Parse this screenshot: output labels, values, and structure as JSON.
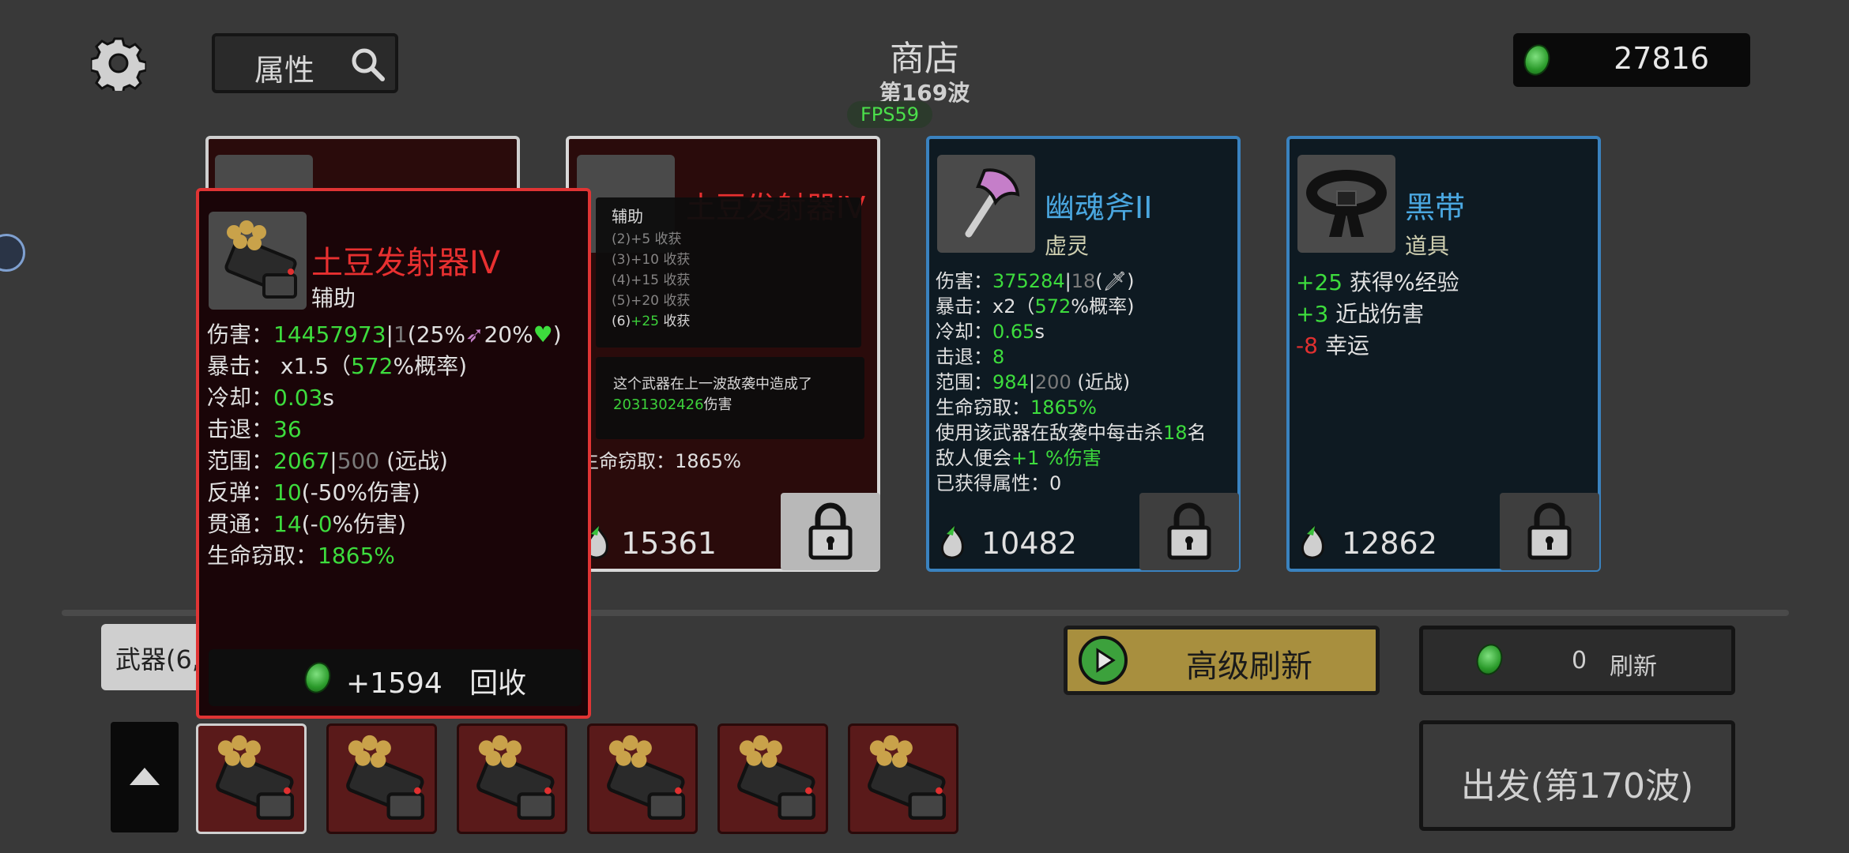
{
  "topbar": {
    "search_label": "属性",
    "title": "商店",
    "wave": "第169波",
    "fps": "FPS59",
    "money": "27816"
  },
  "cards": [
    {
      "name": "",
      "type": "",
      "price": ""
    },
    {
      "name": "土豆发射器IV",
      "type": "辅助",
      "price": "15361",
      "stats_partial": [
        "生命窃取：1865%"
      ]
    },
    {
      "name": "幽魂斧II",
      "type": "虚灵",
      "price": "10482",
      "stats": {
        "damage_label": "伤害：",
        "damage": "375284",
        "damage_sep": "|",
        "damage_base": "18",
        "damage_tail": "(🗡)",
        "crit_label": "暴击：",
        "crit": "x2（",
        "crit_chance": "572",
        "crit_tail": "%概率)",
        "cooldown_label": "冷却：",
        "cooldown": "0.65",
        "cooldown_unit": "s",
        "knockback_label": "击退：",
        "knockback": "8",
        "range_label": "范围：",
        "range": "984",
        "range_sep": "|",
        "range_base": "200",
        "range_tail": " (近战)",
        "lifesteal_label": "生命窃取：",
        "lifesteal": "1865%",
        "effect_1": "使用该武器在敌袭中每击杀",
        "effect_kills": "18",
        "effect_2": "名",
        "effect_3": "敌人便会",
        "effect_bonus": "+1 %伤害",
        "gained_label": "已获得属性：",
        "gained": "0"
      }
    },
    {
      "name": "黑带",
      "type": "道具",
      "price": "12862",
      "effects": [
        {
          "value": "+25",
          "text": " 获得%经验",
          "color": "green"
        },
        {
          "value": "+3",
          "text": " 近战伤害",
          "color": "green"
        },
        {
          "value": "-8",
          "text": " 幸运",
          "color": "red"
        }
      ]
    }
  ],
  "tooltip": {
    "name": "土豆发射器IV",
    "type": "辅助",
    "damage_label": "伤害：",
    "damage": "14457973",
    "damage_sep": "|",
    "damage_base": "1",
    "damage_tail": "(25%",
    "damage_tail2": "20%",
    "damage_end": ")",
    "crit_label": "暴击：",
    "crit": " x1.5（",
    "crit_chance": "572",
    "crit_tail": "%概率)",
    "cooldown_label": "冷却：",
    "cooldown": "0.03",
    "cooldown_unit": "s",
    "knockback_label": "击退：",
    "knockback": "36",
    "range_label": "范围：",
    "range": "2067",
    "range_sep": "|",
    "range_base": "500",
    "range_tail": " (远战)",
    "bounce_label": "反弹：",
    "bounce": "10",
    "bounce_tail": "(-50%伤害)",
    "pierce_label": "贯通：",
    "pierce": "14",
    "pierce_tail_1": "(-",
    "pierce_zero": "0",
    "pierce_tail_2": "%伤害)",
    "lifesteal_label": "生命窃取：",
    "lifesteal": "1865%",
    "recycle_value": "+1594",
    "recycle_label": "回收"
  },
  "synergy": {
    "heading": "辅助",
    "rows": [
      {
        "text": "(2)+5 收获",
        "active": false
      },
      {
        "text": "(3)+10 收获",
        "active": false
      },
      {
        "text": "(4)+15 收获",
        "active": false
      },
      {
        "text": "(5)+20 收获",
        "active": false
      }
    ],
    "active_prefix": "(6)",
    "active_value": "+25",
    "active_suffix": " 收获"
  },
  "damage_popup": {
    "text_1": "这个武器在上一波敌袭中造成了",
    "value": "2031302426",
    "text_2": "伤害"
  },
  "weapons_tab": "武器(6,",
  "buttons": {
    "advanced_refresh": "高级刷新",
    "refresh_cost": "0",
    "refresh": "刷新",
    "go": "出发(第170波)"
  },
  "inventory": {
    "count": 6,
    "selected": 0
  }
}
